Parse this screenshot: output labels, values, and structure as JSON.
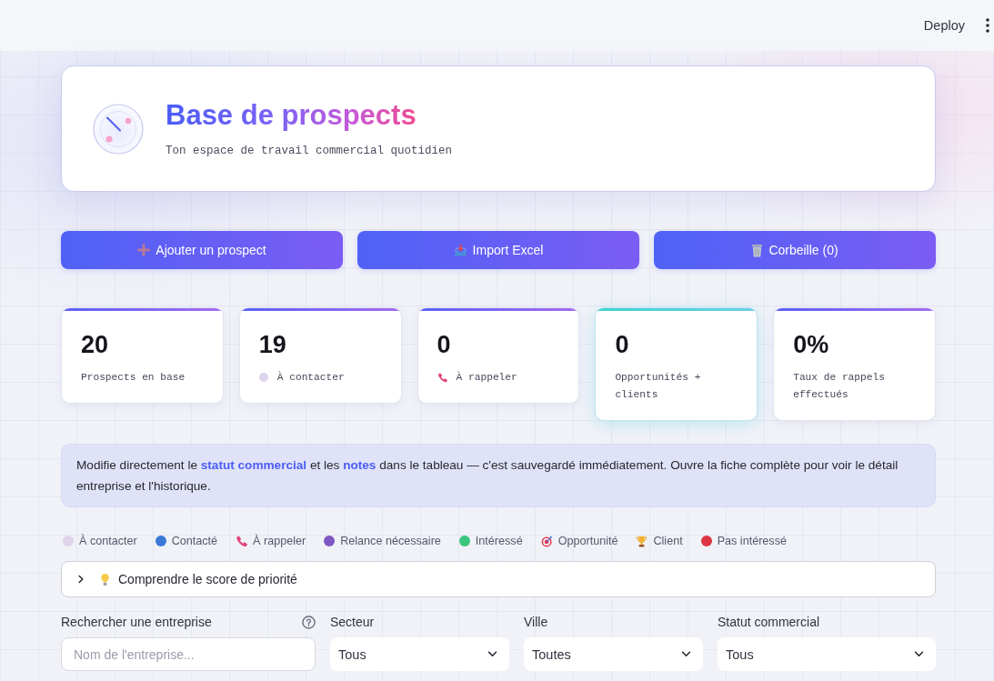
{
  "header": {
    "deploy_button": "Deploy"
  },
  "hero": {
    "title": "Base de prospects",
    "subtitle": "Ton espace de travail commercial quotidien"
  },
  "actions": [
    {
      "kind": "add",
      "label": "Ajouter un prospect"
    },
    {
      "kind": "import",
      "label": "Import Excel"
    },
    {
      "kind": "trash",
      "label": "Corbeille (0)"
    }
  ],
  "stats": [
    {
      "kind": "plain",
      "value": "20",
      "label": "Prospects en base",
      "highlighted": false
    },
    {
      "kind": "dot",
      "color": "#ddd3ea",
      "value": "19",
      "label": "À contacter",
      "highlighted": false
    },
    {
      "kind": "phone",
      "value": "0",
      "label": "À rappeler",
      "highlighted": false
    },
    {
      "kind": "plain",
      "value": "0",
      "label": "Opportunités + clients",
      "highlighted": true
    },
    {
      "kind": "plain",
      "value": "0%",
      "label": "Taux de rappels effectués",
      "highlighted": false
    }
  ],
  "info": "Modifie directement le **statut commercial** et les **notes** dans le tableau — c'est sauvegardé immédiatement. Ouvre la fiche complète pour voir le détail entreprise et l'historique.",
  "legend": [
    {
      "kind": "dot",
      "color": "#ddd3ea",
      "label": "À contacter"
    },
    {
      "kind": "dot",
      "color": "#3b78d8",
      "label": "Contacté"
    },
    {
      "kind": "phone",
      "label": "À rappeler"
    },
    {
      "kind": "dot",
      "color": "#7e57c2",
      "label": "Relance nécessaire"
    },
    {
      "kind": "dot",
      "color": "#3cc47c",
      "label": "Intéressé"
    },
    {
      "kind": "target",
      "label": "Opportunité"
    },
    {
      "kind": "trophy",
      "label": "Client"
    },
    {
      "kind": "dot",
      "color": "#dc3545",
      "label": "Pas intéressé"
    }
  ],
  "expander": {
    "label": "Comprendre le score de priorité",
    "expanded": false
  },
  "filters": [
    {
      "kind": "text",
      "label": "Rechercher une entreprise",
      "help": true,
      "placeholder": "Nom de l'entreprise..."
    },
    {
      "kind": "select",
      "label": "Secteur",
      "help": false,
      "value": "Tous"
    },
    {
      "kind": "select",
      "label": "Ville",
      "help": false,
      "value": "Toutes"
    },
    {
      "kind": "select",
      "label": "Statut commercial",
      "help": false,
      "value": "Tous"
    }
  ]
}
